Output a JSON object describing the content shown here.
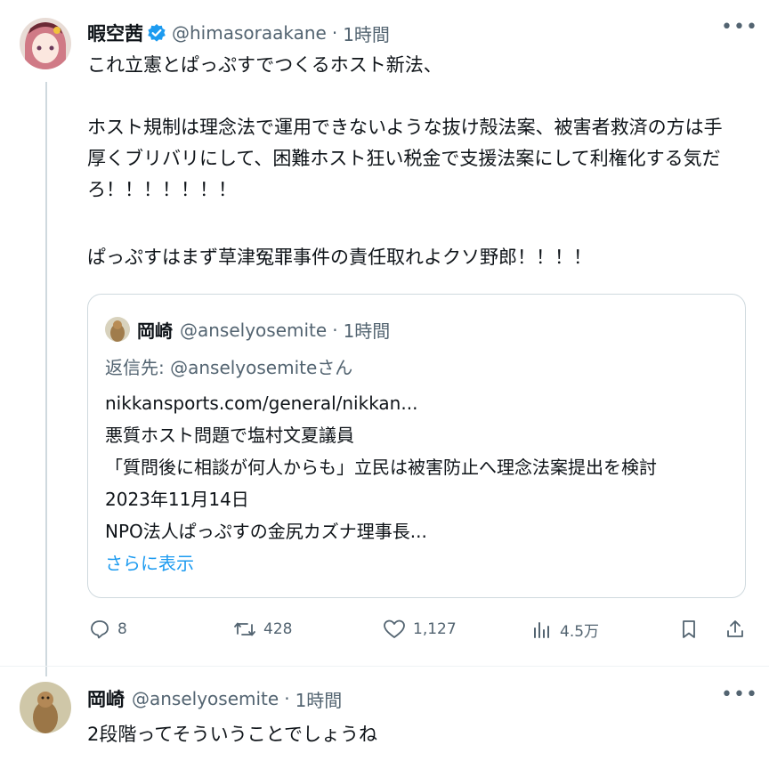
{
  "main_post": {
    "display_name": "暇空茜",
    "handle": "@himasoraakane",
    "separator": "·",
    "time": "1時間",
    "body_line1": "これ立憲とぱっぷすでつくるホスト新法、",
    "body_line2": "ホスト規制は理念法で運用できないような抜け殻法案、被害者救済の方は手",
    "body_line3": "厚くブリバリにして、困難ホスト狂い税金で支援法案にして利権化する気だ",
    "body_line4": "ろ！！！！！！！",
    "body_line5": "ぱっぷすはまず草津冤罪事件の責任取れよクソ野郎！！！！",
    "more_icon": "more-dots-icon",
    "verified_icon": "verified-badge-icon",
    "verified_color": "#1d9bf0"
  },
  "quote": {
    "display_name": "岡崎",
    "handle": "@anselyosemite",
    "separator": "·",
    "time": "1時間",
    "reply_to": "返信先: @anselyosemiteさん",
    "line1": "nikkansports.com/general/nikkan...",
    "line2": "悪質ホスト問題で塩村文夏議員",
    "line3": "「質問後に相談が何人からも」立民は被害防止へ理念法案提出を検討",
    "line4": "2023年11月14日",
    "line5": "NPO法人ぱっぷすの金尻カズナ理事長...",
    "show_more": "さらに表示",
    "link_color": "#1d9bf0"
  },
  "actions": {
    "reply_count": "8",
    "retweet_count": "428",
    "like_count": "1,127",
    "views_count": "4.5万"
  },
  "reply_post": {
    "display_name": "岡崎",
    "handle": "@anselyosemite",
    "separator": "·",
    "time": "1時間",
    "body": "2段階ってそういうことでしょうね"
  }
}
